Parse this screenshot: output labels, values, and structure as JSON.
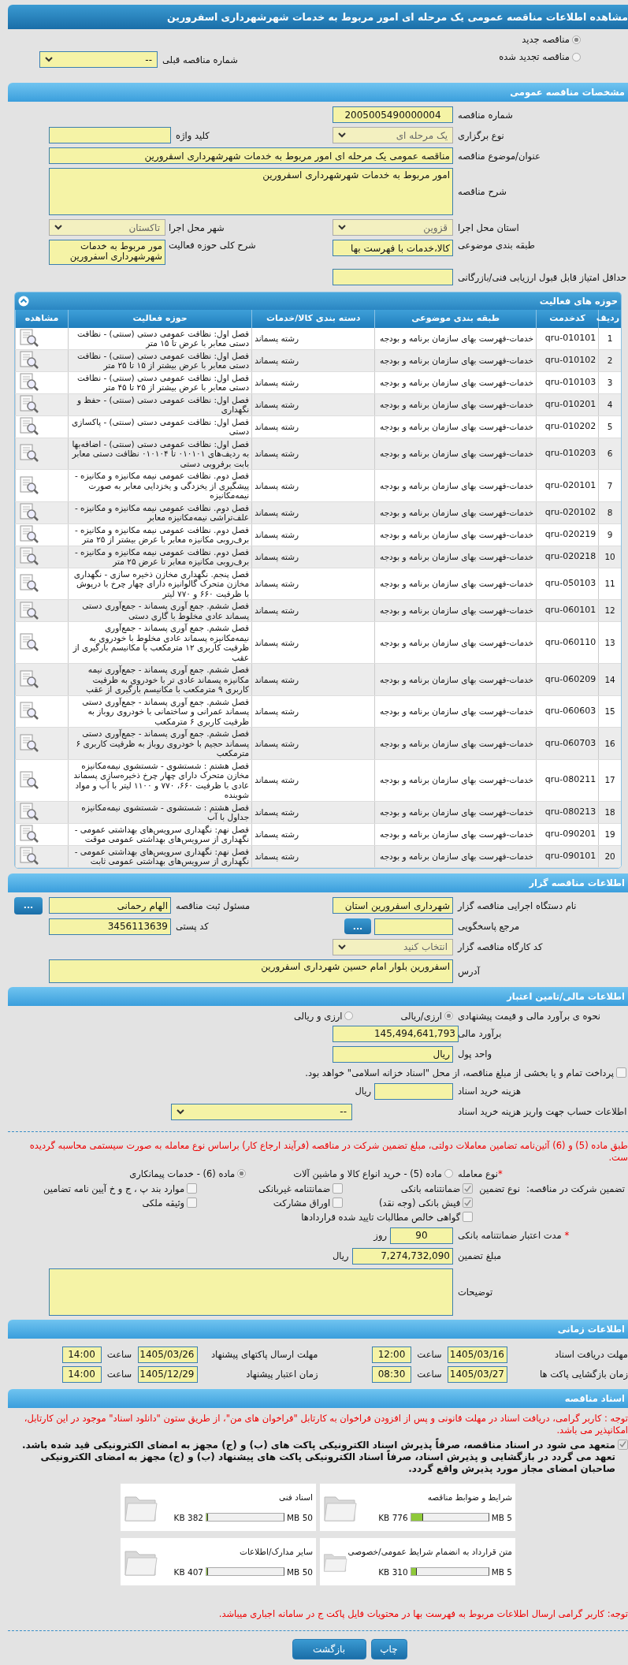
{
  "page_title": "مشاهده اطلاعات مناقصه عمومی یک مرحله ای امور مربوط به خدمات شهرشهرداری اسفرورین",
  "tender_kinds": [
    {
      "label": "مناقصه جدید",
      "selected": true
    },
    {
      "label": "مناقصه تجدید شده",
      "selected": false
    }
  ],
  "previous_tender": {
    "label": "شماره مناقصه قبلی",
    "value": "--"
  },
  "general": {
    "title": "مشخصات مناقصه عمومی",
    "tender_number": {
      "label": "شماره مناقصه",
      "value": "2005005490000004"
    },
    "holding_type": {
      "label": "نوع برگزاری",
      "value": "یک مرحله ای"
    },
    "keyword": {
      "label": "کلید واژه"
    },
    "subject": {
      "label": "عنوان/موضوع مناقصه",
      "value": "مناقصه عمومی یک مرحله ای امور مربوط به خدمات شهرشهرداری اسفرورین"
    },
    "description": {
      "label": "شرح مناقصه",
      "value": "امور مربوط به خدمات شهرشهرداری اسفرورین"
    },
    "province": {
      "label": "استان محل اجرا",
      "value": "قزوین"
    },
    "city": {
      "label": "شهر محل اجرا",
      "value": "تاکستان"
    },
    "category": {
      "label": "طبقه بندی موضوعی",
      "value": "کالا،خدمات با فهرست بها"
    },
    "activity_scope": {
      "label": "شرح کلی حوزه فعالیت",
      "value": "مور مربوط به خدمات شهرشهرداری اسفرورین"
    },
    "min_score": {
      "label": "حداقل امتیاز قابل قبول ارزیابی فنی/بازرگانی"
    }
  },
  "activities": {
    "title": "حوزه های فعالیت",
    "columns": [
      "ردیف",
      "کدخدمت",
      "طبقه بندی موضوعی",
      "دسته بندی کالا/خدمات",
      "حوزه فعالیت",
      "مشاهده"
    ],
    "rows": [
      {
        "index": "1",
        "code": "qru-010101",
        "classification": "خدمات-فهرست بهای سازمان برنامه و بودجه",
        "category": "رشته پسماند",
        "activity": "فصل اول: نظافت عمومی دستی (سنتی) - نظافت دستی معابر با عرض تا ۱۵ متر"
      },
      {
        "index": "2",
        "code": "qru-010102",
        "classification": "خدمات-فهرست بهای سازمان برنامه و بودجه",
        "category": "رشته پسماند",
        "activity": "فصل اول: نظافت عمومی دستی (سنتی) - نظافت دستی معابر با عرض بیشتر از ۱۵ تا ۲۵ متر"
      },
      {
        "index": "3",
        "code": "qru-010103",
        "classification": "خدمات-فهرست بهای سازمان برنامه و بودجه",
        "category": "رشته پسماند",
        "activity": "فصل اول: نظافت عمومی دستی (سنتی) - نظافت دستی معابر با عرض بیشتر از ۲۵ تا ۴۵ متر"
      },
      {
        "index": "4",
        "code": "qru-010201",
        "classification": "خدمات-فهرست بهای سازمان برنامه و بودجه",
        "category": "رشته پسماند",
        "activity": "فصل اول: نظافت عمومی دستی (سنتی) - حفظ و نگهداری"
      },
      {
        "index": "5",
        "code": "qru-010202",
        "classification": "خدمات-فهرست بهای سازمان برنامه و بودجه",
        "category": "رشته پسماند",
        "activity": "فصل اول: نظافت عمومی دستی (سنتی) - پاکسازی دستی"
      },
      {
        "index": "6",
        "code": "qru-010203",
        "classification": "خدمات-فهرست بهای سازمان برنامه و بودجه",
        "category": "رشته پسماند",
        "activity": "فصل اول: نظافت عمومی دستی (سنتی) - اضافه‌بها به ردیف‌های ۰۱۰۱۰۱ تا ۰۱۰۱۰۴ نظافت دستی معابر بابت برفروبی دستی"
      },
      {
        "index": "7",
        "code": "qru-020101",
        "classification": "خدمات-فهرست بهای سازمان برنامه و بودجه",
        "category": "رشته پسماند",
        "activity": "فصل دوم. نظافت عمومی نیمه مکانیزه و مکانیزه - پیشگیری از یخزدگی و یخزدایی معابر به صورت نیمه‌مکانیزه"
      },
      {
        "index": "8",
        "code": "qru-020102",
        "classification": "خدمات-فهرست بهای سازمان برنامه و بودجه",
        "category": "رشته پسماند",
        "activity": "فصل دوم. نظافت عمومی نیمه مکانیزه و مکانیزه - علف‌تراشی نیمه‌مکانیزه معابر"
      },
      {
        "index": "9",
        "code": "qru-020219",
        "classification": "خدمات-فهرست بهای سازمان برنامه و بودجه",
        "category": "رشته پسماند",
        "activity": "فصل دوم. نظافت عمومی نیمه مکانیزه و مکانیزه - برف‌روبی مکانیزه معابر با عرض بیشتر از ۲۵ متر"
      },
      {
        "index": "10",
        "code": "qru-020218",
        "classification": "خدمات-فهرست بهای سازمان برنامه و بودجه",
        "category": "رشته پسماند",
        "activity": "فصل دوم. نظافت عمومی نیمه مکانیزه و مکانیزه - برف‌روبی مکانیزه معابر تا عرض ۲۵ متر"
      },
      {
        "index": "11",
        "code": "qru-050103",
        "classification": "خدمات-فهرست بهای سازمان برنامه و بودجه",
        "category": "رشته پسماند",
        "activity": "فصل پنجم. نگهداری مخازن ذخیره سازی - نگهداری مخازن متحرک گالوانیزه دارای چهار چرخ با درپوش با ظرفیت ۶۶۰ و ۷۷۰ لیتر"
      },
      {
        "index": "12",
        "code": "qru-060101",
        "classification": "خدمات-فهرست بهای سازمان برنامه و بودجه",
        "category": "رشته پسماند",
        "activity": "فصل ششم. جمع آوری پسماند - جمع‌آوری دستی پسماند عادی مخلوط با گاری دستی"
      },
      {
        "index": "13",
        "code": "qru-060110",
        "classification": "خدمات-فهرست بهای سازمان برنامه و بودجه",
        "category": "رشته پسماند",
        "activity": "فصل ششم. جمع آوری پسماند - جمع‌آوری نیمه‌مکانیزه پسماند عادی مخلوط با خودروی به ظرفیت کاربری ۱۲ مترمکعب با مکانیسم بارگیری از عقب"
      },
      {
        "index": "14",
        "code": "qru-060209",
        "classification": "خدمات-فهرست بهای سازمان برنامه و بودجه",
        "category": "رشته پسماند",
        "activity": "فصل ششم. جمع آوری پسماند - جمع‌آوری نیمه مکانیزه پسماند عادی تر با خودروی به ظرفیت کاربری ۹ مترمکعب با مکانیسم بارگیری از عقب"
      },
      {
        "index": "15",
        "code": "qru-060603",
        "classification": "خدمات-فهرست بهای سازمان برنامه و بودجه",
        "category": "رشته پسماند",
        "activity": "فصل ششم. جمع آوری پسماند - جمع‌آوری دستی پسماند عمرانی و ساختمانی با خودروی روباز به ظرفیت کاربری ۶ مترمکعب"
      },
      {
        "index": "16",
        "code": "qru-060703",
        "classification": "خدمات-فهرست بهای سازمان برنامه و بودجه",
        "category": "رشته پسماند",
        "activity": "فصل ششم. جمع آوری پسماند - جمع‌آوری دستی پسماند حجیم با خودروی روباز به ظرفیت کاربری ۶ مترمکعب"
      },
      {
        "index": "17",
        "code": "qru-080211",
        "classification": "خدمات-فهرست بهای سازمان برنامه و بودجه",
        "category": "رشته پسماند",
        "activity": "فصل هشتم : شستشوی - شستشوی نیمه‌مکانیزه مخازن متحرک دارای چهار چرخ ذخیره‌سازی پسماند عادی با ظرفیت ۶۶۰، ۷۷۰ و ۱۱۰۰ لیتر با آب و مواد شوینده"
      },
      {
        "index": "18",
        "code": "qru-080213",
        "classification": "خدمات-فهرست بهای سازمان برنامه و بودجه",
        "category": "رشته پسماند",
        "activity": "فصل هشتم : شستشوی - شستشوی نیمه‌مکانیزه جداول با آب"
      },
      {
        "index": "19",
        "code": "qru-090201",
        "classification": "خدمات-فهرست بهای سازمان برنامه و بودجه",
        "category": "رشته پسماند",
        "activity": "فصل نهم: نگهداری سرویس‌های بهداشتی عمومی - نگهداری از سرویس‌های بهداشتی عمومی موقت"
      },
      {
        "index": "20",
        "code": "qru-090101",
        "classification": "خدمات-فهرست بهای سازمان برنامه و بودجه",
        "category": "رشته پسماند",
        "activity": "فصل نهم: نگهداری سرویس‌های بهداشتی عمومی - نگهداری از سرویس‌های بهداشتی عمومی ثابت"
      }
    ]
  },
  "tenderer": {
    "title": "اطلاعات مناقصه گزار",
    "organization": {
      "label": "نام دستگاه اجرایی مناقصه گزار",
      "value": "شهرداری اسفرورین استان"
    },
    "registrar": {
      "label": "مسئول ثبت مناقصه",
      "value": "الهام رحمانی",
      "button": "..."
    },
    "reference": {
      "label": "مرجع پاسخگویی",
      "button": "..."
    },
    "postal_code": {
      "label": "کد پستی",
      "value": "3456113639"
    },
    "workshop_code": {
      "label": "کد کارگاه مناقصه گزار",
      "value": "انتخاب کنید"
    },
    "address": {
      "label": "آدرس",
      "value": "اسفرورین بلوار امام حسین شهرداری اسفرورین"
    }
  },
  "finance": {
    "title": "اطلاعات مالی/تامین اعتبار",
    "estimate_method": {
      "label": "نحوه ی برآورد مالی و قیمت پیشنهادی",
      "options": [
        {
          "label": "ارزی/ریالی",
          "selected": true
        },
        {
          "label": "ارزی و ریالی",
          "selected": false
        }
      ]
    },
    "estimate": {
      "label": "برآورد مالی",
      "value": "145,494,641,793"
    },
    "currency": {
      "label": "واحد پول",
      "value": "ریال"
    },
    "treasury": {
      "label": "پرداخت تمام و یا بخشی از مبلغ مناقصه، از محل \"اسناد خزانه اسلامی\" خواهد بود.",
      "checked": false
    },
    "document_cost": {
      "label": "هزینه خرید اسناد",
      "unit": "ریال"
    },
    "account": {
      "label": "اطلاعات حساب جهت واریز هزینه خرید اسناد",
      "value": "--"
    },
    "guarantee_note": "طبق ماده (5) و (6) آئین‌نامه تضامین معاملات دولتی، مبلغ تضمین شرکت در مناقصه (فرآیند ارجاع کار) براساس نوع معامله به صورت سیستمی محاسبه گردیده ست.",
    "deal_type": {
      "label": "نوع معامله",
      "required": "*",
      "options": [
        {
          "label": "ماده (5) - خرید انواع کالا و ماشین آلات",
          "selected": false
        },
        {
          "label": "ماده (6) - خدمات پیمانکاری",
          "selected": true
        }
      ]
    },
    "guarantee_label": "تضمین شرکت در مناقصه:",
    "guarantee_type_label": "نوع تضمین",
    "guarantee_types": [
      {
        "label": "ضمانتنامه بانکی",
        "checked": true
      },
      {
        "label": "ضمانتنامه غیربانکی",
        "checked": false
      },
      {
        "label": "موارد بند پ ، ج و خ آیین نامه تضامین",
        "checked": false
      },
      {
        "label": "فیش بانکی (وجه نقد)",
        "checked": true
      },
      {
        "label": "اوراق مشارکت",
        "checked": false
      },
      {
        "label": "وثیقه ملکی",
        "checked": false
      },
      {
        "label": "گواهی خالص مطالبات تایید شده قراردادها",
        "checked": false
      }
    ],
    "validity": {
      "label": "مدت اعتبار ضمانتنامه بانکی",
      "required": "*",
      "value": "90",
      "unit": "روز"
    },
    "guarantee_amount": {
      "label": "مبلغ تضمین",
      "value": "7,274,732,090",
      "unit": "ریال"
    },
    "notes": {
      "label": "توضیحات"
    }
  },
  "timing": {
    "title": "اطلاعات زمانی",
    "items": [
      {
        "label": "مهلت دریافت اسناد",
        "date": "1405/03/16",
        "hour_label": "ساعت",
        "time": "12:00"
      },
      {
        "label": "مهلت ارسال پاکتهای پیشنهاد",
        "date": "1405/03/26",
        "hour_label": "ساعت",
        "time": "14:00"
      },
      {
        "label": "زمان بازگشایی پاکت ها",
        "date": "1405/03/27",
        "hour_label": "ساعت",
        "time": "08:30"
      },
      {
        "label": "زمان اعتبار پیشنهاد",
        "date": "1405/12/29",
        "hour_label": "ساعت",
        "time": "14:00"
      }
    ]
  },
  "documents": {
    "title": "اسناد مناقصه",
    "notice": "توجه : کاربر گرامی، دریافت اسناد در مهلت قانونی و پس از افزودن فراخوان به کارتابل \"فراخوان های من\"، از طریق ستون \"دانلود اسناد\" موجود در این کارتابل، امکانپذیر می باشد.",
    "commitment": {
      "text": "متعهد می شود در اسناد مناقصه، صرفاً پذیرش اسناد الکترونیکی پاکت های (ب) و (ج) مجهز به امضای الکترونیکی قید شده باشد. تعهد می گردد در بازگشایی و پذیرش اسناد، صرفاً اسناد الکترونیکی پاکت های پیشنهاد (ب) و (ج) مجهز به امضای الکترونیکی صاحبان امضای مجاز مورد پذیرش واقع گردد.",
      "checked": true
    },
    "files": [
      {
        "name": "شرایط و ضوابط مناقصه",
        "size": "776 KB",
        "max": "5 MB",
        "level": 0.15
      },
      {
        "name": "اسناد فنی",
        "size": "382 KB",
        "max": "50 MB",
        "level": 0.01
      },
      {
        "name": "متن قرارداد به انضمام شرایط عمومی/خصوصی",
        "size": "310 KB",
        "max": "5 MB",
        "level": 0.06
      },
      {
        "name": "سایر مدارک/اطلاعات",
        "size": "407 KB",
        "max": "50 MB",
        "level": 0.01
      }
    ],
    "footer_note": "توجه: کاربر گرامی ارسال اطلاعات مربوط به فهرست بها در محتویات فایل پاکت ج در سامانه اجباری میباشد."
  },
  "buttons": [
    {
      "label": "چاپ"
    },
    {
      "label": "بازگشت"
    }
  ]
}
